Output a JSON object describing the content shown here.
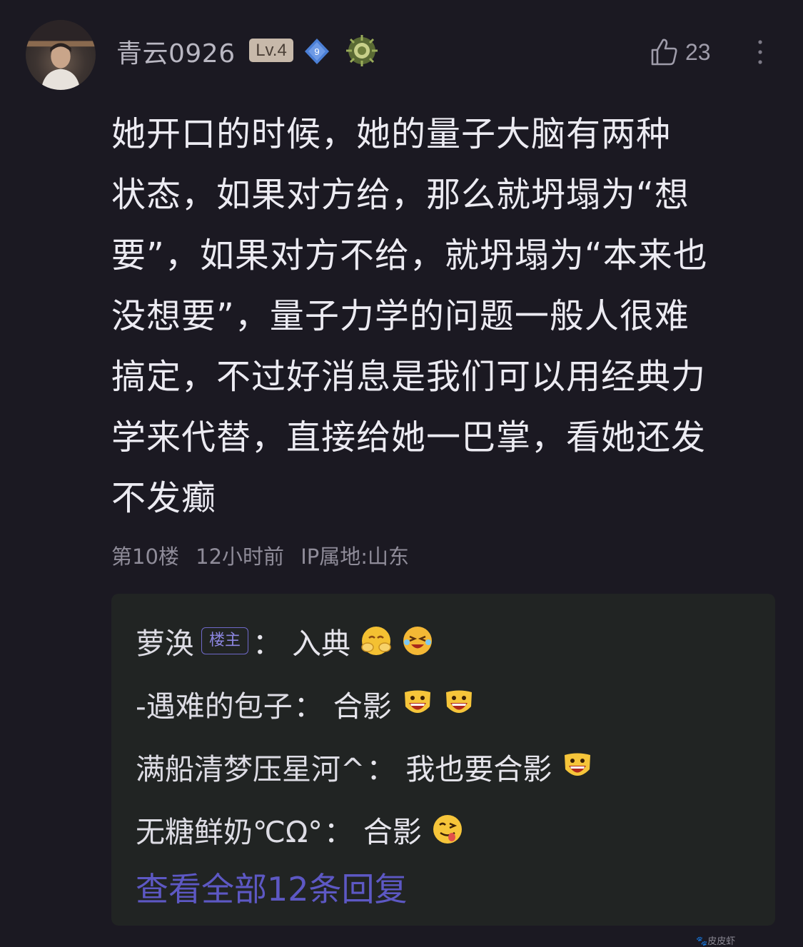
{
  "comment": {
    "username": "青云0926",
    "level": "Lv.4",
    "vip_level": "9",
    "likes": "23",
    "lines": [
      "她开口的时候，她的量子大脑有两种",
      "状态，如果对方给，那么就坍塌为“想",
      "要”，如果对方不给，就坍塌为“本来也",
      "没想要”，量子力学的问题一般人很难",
      "搞定，不过好消息是我们可以用经典力",
      "学来代替，直接给她一巴掌，看她还发",
      "不发癫"
    ],
    "floor": "第10楼",
    "time": "12小时前",
    "ip": "IP属地:山东"
  },
  "replies": [
    {
      "name": "萝涣",
      "tag": "楼主",
      "text": "入典",
      "emojis": [
        "cover-face-emoji",
        "crying-laugh-emoji"
      ]
    },
    {
      "name": "-遇难的包子",
      "tag": "",
      "text": "合影",
      "emojis": [
        "grin-emoji",
        "grin-emoji"
      ]
    },
    {
      "name": "满船清梦压星河^",
      "tag": "",
      "text": "我也要合影",
      "emojis": [
        "grin-emoji"
      ]
    },
    {
      "name": "无糖鲜奶℃Ω°",
      "tag": "",
      "text": "合影",
      "emojis": [
        "tongue-emoji"
      ]
    }
  ],
  "separator": "：",
  "view_all": "查看全部12条回复",
  "watermark": "皮皮虾",
  "colors": {
    "background": "#1b1922",
    "reply_box": "#212423",
    "link": "#5d58c4",
    "level_badge": "#c7b9aa",
    "vip_badge": "#4b7fd6"
  }
}
